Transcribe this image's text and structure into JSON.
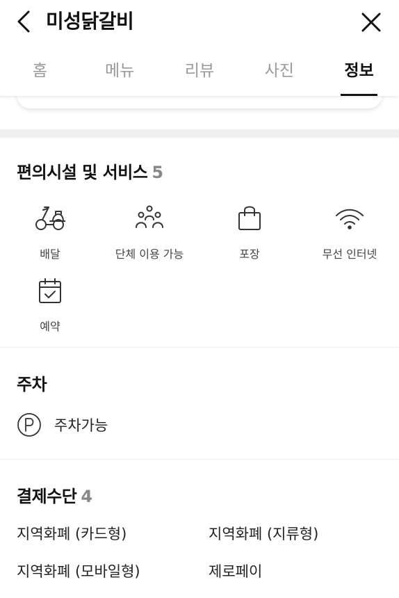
{
  "header": {
    "title": "미성닭갈비"
  },
  "tabs": [
    {
      "label": "홈",
      "active": false
    },
    {
      "label": "메뉴",
      "active": false
    },
    {
      "label": "리뷰",
      "active": false
    },
    {
      "label": "사진",
      "active": false
    },
    {
      "label": "정보",
      "active": true
    }
  ],
  "facilities": {
    "title": "편의시설 및 서비스",
    "count": "5",
    "items": [
      {
        "label": "배달",
        "icon": "scooter-icon"
      },
      {
        "label": "단체 이용 가능",
        "icon": "group-icon"
      },
      {
        "label": "포장",
        "icon": "bag-icon"
      },
      {
        "label": "무선 인터넷",
        "icon": "wifi-icon"
      },
      {
        "label": "예약",
        "icon": "calendar-check-icon"
      }
    ]
  },
  "parking": {
    "title": "주차",
    "icon": "parking-icon",
    "label": "주차가능"
  },
  "payment": {
    "title": "결제수단",
    "count": "4",
    "methods": [
      "지역화폐 (카드형)",
      "지역화폐 (지류형)",
      "지역화폐 (모바일형)",
      "제로페이"
    ]
  },
  "colors": {
    "text": "#111111",
    "muted": "#999999",
    "count": "#888888",
    "divider": "#efefef"
  }
}
